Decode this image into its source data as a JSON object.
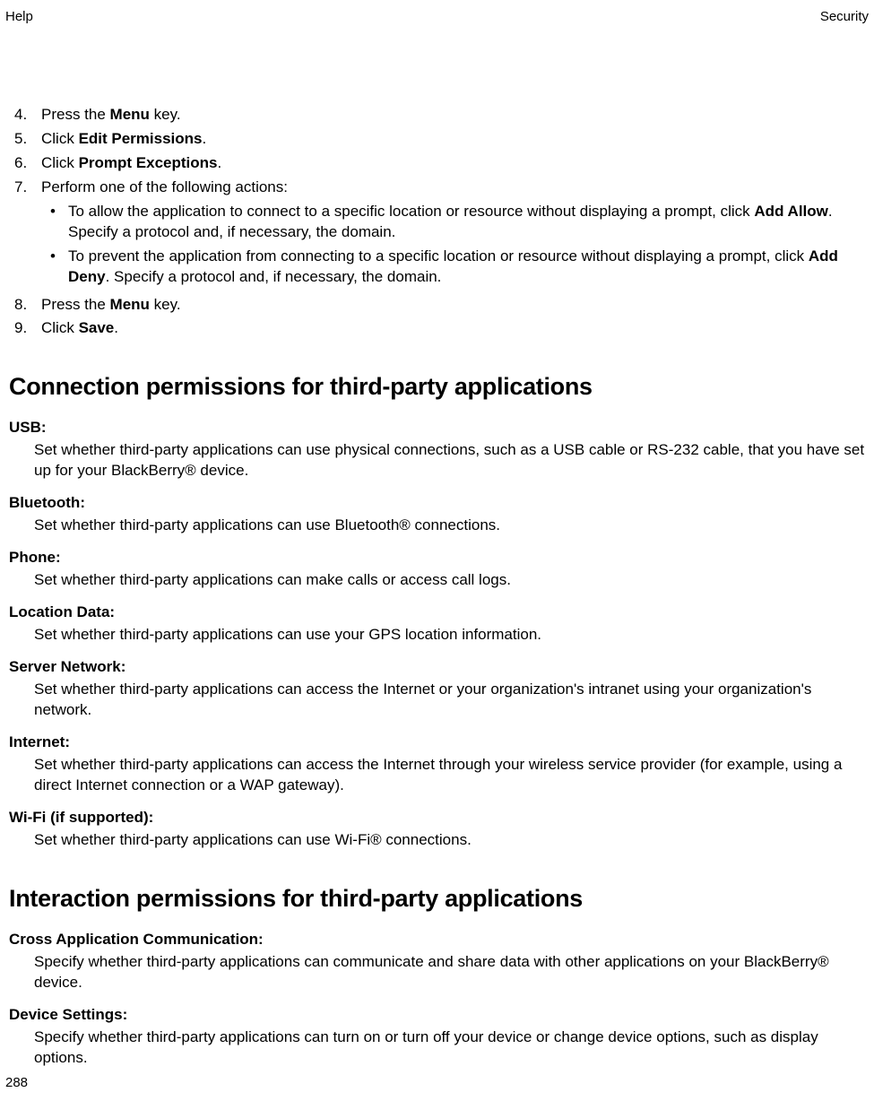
{
  "header": {
    "left": "Help",
    "right": "Security"
  },
  "steps": {
    "s4": {
      "num": "4.",
      "pre": "Press the ",
      "bold": "Menu",
      "post": " key."
    },
    "s5": {
      "num": "5.",
      "pre": "Click ",
      "bold": "Edit Permissions",
      "post": "."
    },
    "s6": {
      "num": "6.",
      "pre": "Click ",
      "bold": "Prompt Exceptions",
      "post": "."
    },
    "s7": {
      "num": "7.",
      "text": "Perform one of the following actions:"
    },
    "s7a": {
      "pre": "To allow the application to connect to a specific location or resource without displaying a prompt, click ",
      "bold": "Add Allow",
      "post": ". Specify a protocol and, if necessary, the domain."
    },
    "s7b": {
      "pre": "To prevent the application from connecting to a specific location or resource without displaying a prompt, click ",
      "bold": "Add Deny",
      "post": ". Specify a protocol and, if necessary, the domain."
    },
    "s8": {
      "num": "8.",
      "pre": "Press the ",
      "bold": "Menu",
      "post": " key."
    },
    "s9": {
      "num": "9.",
      "pre": "Click ",
      "bold": "Save",
      "post": "."
    }
  },
  "section1": {
    "title": "Connection permissions for third-party applications",
    "defs": {
      "usb": {
        "term": "USB:",
        "desc": "Set whether third-party applications can use physical connections, such as a USB cable or RS-232 cable, that you have set up for your BlackBerry® device."
      },
      "bluetooth": {
        "term": "Bluetooth:",
        "desc": "Set whether third-party applications can use Bluetooth® connections."
      },
      "phone": {
        "term": "Phone:",
        "desc": "Set whether third-party applications can make calls or access call logs."
      },
      "location": {
        "term": "Location Data:",
        "desc": "Set whether third-party applications can use your GPS location information."
      },
      "server": {
        "term": "Server Network:",
        "desc": "Set whether third-party applications can access the Internet or your organization's intranet using your organization's network."
      },
      "internet": {
        "term": "Internet:",
        "desc": "Set whether third-party applications can access the Internet through your wireless service provider (for example, using a direct Internet connection or a WAP gateway)."
      },
      "wifi": {
        "term": "Wi-Fi (if supported):",
        "desc": "Set whether third-party applications can use Wi-Fi® connections."
      }
    }
  },
  "section2": {
    "title": "Interaction permissions for third-party applications",
    "defs": {
      "cross": {
        "term": "Cross Application Communication:",
        "desc": "Specify whether third-party applications can communicate and share data with other applications on your BlackBerry® device."
      },
      "device": {
        "term": "Device Settings:",
        "desc": "Specify whether third-party applications can turn on or turn off your device or change device options, such as display options."
      }
    }
  },
  "footer": {
    "page": "288"
  },
  "bullet": "•"
}
